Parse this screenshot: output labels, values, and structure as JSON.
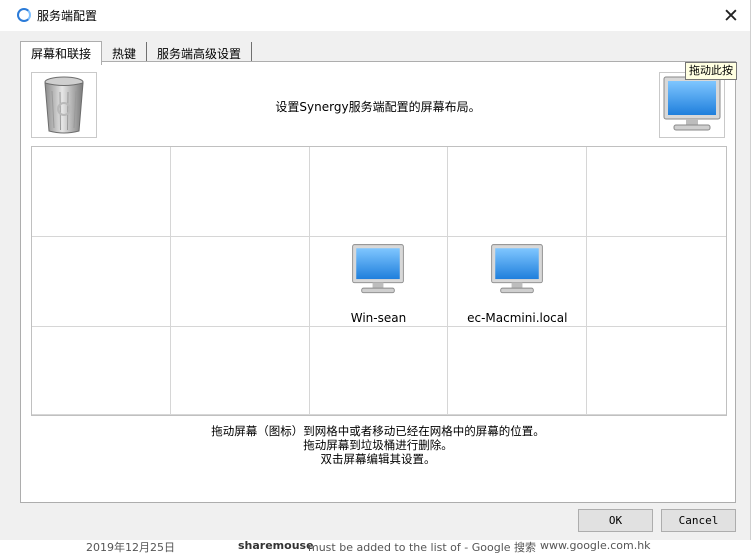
{
  "window": {
    "title": "服务端配置",
    "close_glyph": "✕"
  },
  "tabs": [
    {
      "label": "屏幕和联接"
    },
    {
      "label": "热键"
    },
    {
      "label": "服务端高级设置"
    }
  ],
  "panel": {
    "instruction": "设置Synergy服务端配置的屏幕布局。",
    "tooltip": "拖动此按",
    "screens": [
      {
        "name": "Win-sean",
        "icon": "monitor-icon"
      },
      {
        "name": "ec-Macmini.local",
        "icon": "monitor-icon"
      }
    ],
    "hint_lines": [
      "拖动屏幕（图标）到网格中或者移动已经在网格中的屏幕的位置。",
      "拖动屏幕到垃圾桶进行删除。",
      "双击屏幕编辑其设置。"
    ]
  },
  "buttons": {
    "ok": "OK",
    "cancel": "Cancel"
  },
  "background": {
    "date": "2019年12月25日",
    "snippet_bold": "sharemouse",
    "snippet_rest": " must be added to the list of - Google 搜索",
    "url": "www.google.com.hk"
  },
  "colors": {
    "accent": "#2b7bd8",
    "screen_blue": "#3a96ea",
    "tooltip_bg": "#ffffe1"
  }
}
